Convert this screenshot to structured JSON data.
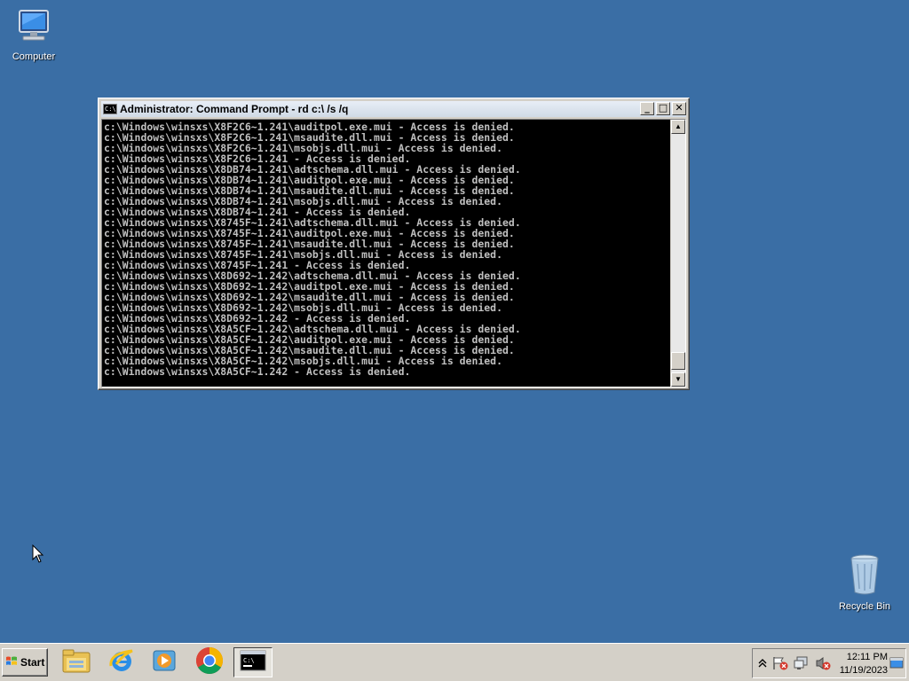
{
  "desktop": {
    "background": "#3a6ea5",
    "icons": [
      {
        "label": "Computer",
        "icon": "computer-icon"
      },
      {
        "label": "Recycle Bin",
        "icon": "recycle-bin-icon"
      }
    ]
  },
  "window": {
    "title_bold": "Administrator:",
    "title_rest": "Command Prompt - rd  c:\\ /s /q",
    "buttons": {
      "minimize": "_",
      "maximize": "□",
      "close": "✕"
    },
    "console_lines": [
      "c:\\Windows\\winsxs\\X8F2C6~1.241\\auditpol.exe.mui - Access is denied.",
      "c:\\Windows\\winsxs\\X8F2C6~1.241\\msaudite.dll.mui - Access is denied.",
      "c:\\Windows\\winsxs\\X8F2C6~1.241\\msobjs.dll.mui - Access is denied.",
      "c:\\Windows\\winsxs\\X8F2C6~1.241 - Access is denied.",
      "c:\\Windows\\winsxs\\X8DB74~1.241\\adtschema.dll.mui - Access is denied.",
      "c:\\Windows\\winsxs\\X8DB74~1.241\\auditpol.exe.mui - Access is denied.",
      "c:\\Windows\\winsxs\\X8DB74~1.241\\msaudite.dll.mui - Access is denied.",
      "c:\\Windows\\winsxs\\X8DB74~1.241\\msobjs.dll.mui - Access is denied.",
      "c:\\Windows\\winsxs\\X8DB74~1.241 - Access is denied.",
      "c:\\Windows\\winsxs\\X8745F~1.241\\adtschema.dll.mui - Access is denied.",
      "c:\\Windows\\winsxs\\X8745F~1.241\\auditpol.exe.mui - Access is denied.",
      "c:\\Windows\\winsxs\\X8745F~1.241\\msaudite.dll.mui - Access is denied.",
      "c:\\Windows\\winsxs\\X8745F~1.241\\msobjs.dll.mui - Access is denied.",
      "c:\\Windows\\winsxs\\X8745F~1.241 - Access is denied.",
      "c:\\Windows\\winsxs\\X8D692~1.242\\adtschema.dll.mui - Access is denied.",
      "c:\\Windows\\winsxs\\X8D692~1.242\\auditpol.exe.mui - Access is denied.",
      "c:\\Windows\\winsxs\\X8D692~1.242\\msaudite.dll.mui - Access is denied.",
      "c:\\Windows\\winsxs\\X8D692~1.242\\msobjs.dll.mui - Access is denied.",
      "c:\\Windows\\winsxs\\X8D692~1.242 - Access is denied.",
      "c:\\Windows\\winsxs\\X8A5CF~1.242\\adtschema.dll.mui - Access is denied.",
      "c:\\Windows\\winsxs\\X8A5CF~1.242\\auditpol.exe.mui - Access is denied.",
      "c:\\Windows\\winsxs\\X8A5CF~1.242\\msaudite.dll.mui - Access is denied.",
      "c:\\Windows\\winsxs\\X8A5CF~1.242\\msobjs.dll.mui - Access is denied.",
      "c:\\Windows\\winsxs\\X8A5CF~1.242 - Access is denied."
    ]
  },
  "taskbar": {
    "start_label": "Start",
    "pinned": [
      {
        "name": "file-explorer-icon"
      },
      {
        "name": "internet-explorer-icon"
      },
      {
        "name": "media-player-icon"
      },
      {
        "name": "chrome-icon"
      },
      {
        "name": "command-prompt-icon",
        "active": true
      }
    ],
    "tray": {
      "icons": [
        "show-hidden-icons-chevron",
        "action-center-flag-icon",
        "network-icon",
        "volume-muted-icon"
      ],
      "time": "12:11 PM",
      "date": "11/19/2023"
    }
  }
}
